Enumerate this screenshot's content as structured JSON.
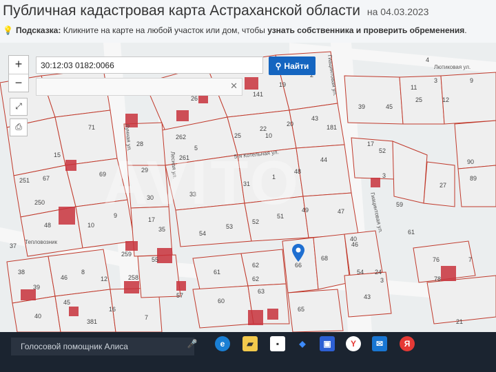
{
  "header": {
    "title": "Публичная кадастровая карта Астраханской области",
    "date": "на 04.03.2023",
    "hint_label": "Подсказка:",
    "hint_text": "Кликните на карте на любой участок или дом, чтобы",
    "hint_bold": "узнать собственника и проверить обременения",
    "hint_end": "."
  },
  "search": {
    "value": "30:12:03 0182:0066",
    "button_label": "Найти",
    "button_icon": "search-icon"
  },
  "controls": {
    "zoom_in": "+",
    "zoom_out": "−",
    "fullscreen_icon": "expand-icon",
    "print_icon": "printer-icon",
    "close_icon": "close-icon"
  },
  "map": {
    "streets": [
      "Лютиковая ул.",
      "Гиацинтовая ул.",
      "5-я Котельная ул.",
      "Лунная ул.",
      "Гиацинтовая ул.",
      "Лесная ул."
    ],
    "place_label": "Тепловозник",
    "selected_plot": "66",
    "watermark": "AVITO",
    "plot_numbers": [
      "20",
      "26",
      "19",
      "141",
      "2",
      "4",
      "11",
      "3",
      "9",
      "25",
      "12",
      "39",
      "45",
      "71",
      "262",
      "10",
      "25",
      "22",
      "20",
      "43",
      "181",
      "17",
      "28",
      "5",
      "52",
      "29",
      "261",
      "1",
      "48",
      "44",
      "3",
      "90",
      "15",
      "30",
      "33",
      "31",
      "49",
      "47",
      "59",
      "27",
      "89",
      "251",
      "250",
      "67",
      "69",
      "17",
      "53",
      "52",
      "51",
      "54",
      "61",
      "46",
      "48",
      "10",
      "9",
      "55",
      "35",
      "54",
      "40",
      "62",
      "78",
      "76",
      "7",
      "37",
      "259",
      "38",
      "46",
      "8",
      "12",
      "66",
      "61",
      "68",
      "62",
      "24",
      "3",
      "258",
      "57",
      "60",
      "39",
      "63",
      "43",
      "45",
      "65",
      "40",
      "381",
      "16",
      "7",
      "21"
    ]
  },
  "taskbar": {
    "assistant": "Голосовой помощник Алиса",
    "icons": [
      "microphone-icon",
      "edge-icon",
      "files-icon",
      "app-icon",
      "dropbox-icon",
      "photos-icon",
      "yandex-icon",
      "mail-icon",
      "yandex-browser-icon"
    ]
  },
  "colors": {
    "accent": "#1565c0",
    "parcel_line": "#c0392b",
    "building": "#c8323c",
    "pin": "#1f6fd1"
  }
}
